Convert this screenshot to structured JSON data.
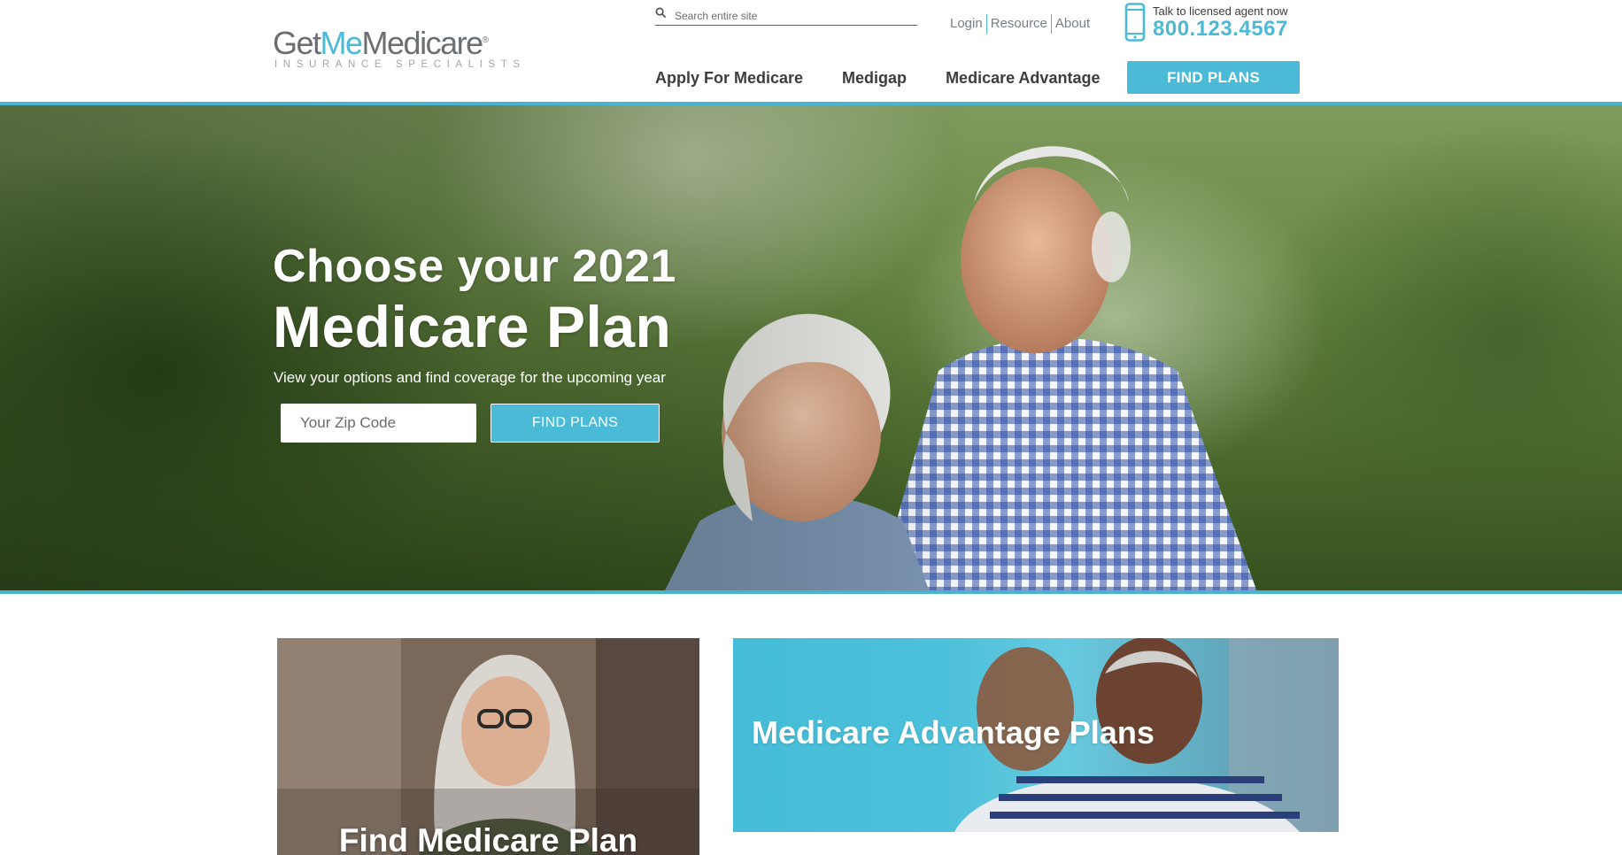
{
  "brand": {
    "word_get": "Get",
    "word_me": "Me",
    "word_medicare": "Medicare",
    "registered": "®",
    "tagline": "INSURANCE SPECIALISTS",
    "accent_color": "#4bbad6"
  },
  "search": {
    "placeholder": "Search entire site",
    "icon": "search-icon"
  },
  "utility_links": [
    "Login",
    "Resource",
    "About"
  ],
  "contact": {
    "caption": "Talk to licensed agent now",
    "phone": "800.123.4567",
    "icon": "phone-icon"
  },
  "nav": {
    "items": [
      "Apply For Medicare",
      "Medigap",
      "Medicare Advantage"
    ],
    "cta": "FIND PLANS"
  },
  "hero": {
    "title_line1": "Choose your 2021",
    "title_line2": "Medicare Plan",
    "subtitle": "View your options and find coverage for the upcoming year",
    "zip_placeholder": "Your Zip Code",
    "cta": "FIND PLANS"
  },
  "cards": {
    "left_title": "Find Medicare Plan",
    "right_title": "Medicare Advantage Plans"
  }
}
